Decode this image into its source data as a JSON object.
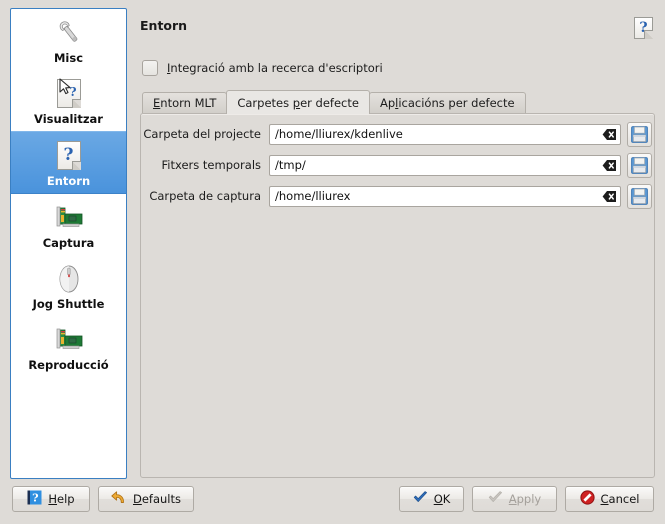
{
  "window": {
    "background": "#dedbd7"
  },
  "sidebar": {
    "items": [
      {
        "label": "Misc",
        "icon": "wrench-icon",
        "selected": false
      },
      {
        "label": "Visualitzar",
        "icon": "document-cursor-icon",
        "selected": false
      },
      {
        "label": "Entorn",
        "icon": "document-question-icon",
        "selected": true
      },
      {
        "label": "Captura",
        "icon": "pci-card-icon",
        "selected": false
      },
      {
        "label": "Jog Shuttle",
        "icon": "mouse-icon",
        "selected": false
      },
      {
        "label": "Reproducció",
        "icon": "pci-card-icon",
        "selected": false
      }
    ],
    "selection_color": "#4a93dc",
    "border_color": "#3a7fc2"
  },
  "main": {
    "title": "Entorn",
    "help_icon": "document-question-icon",
    "checkbox": {
      "label": "Integració amb la recerca d'escriptori",
      "accelerator": "I",
      "checked": false
    },
    "tabs": [
      {
        "label": "Entorn MLT",
        "accelerator": "E",
        "active": false
      },
      {
        "label": "Carpetes per defecte",
        "accelerator": "p",
        "active": true
      },
      {
        "label": "Aplicacións per defecte",
        "accelerator": "l",
        "active": false
      }
    ],
    "fields": [
      {
        "label": "Carpeta del projecte",
        "value": "/home/lliurex/kdenlive",
        "placeholder": "",
        "clear_icon": "clear-text-icon",
        "browse_icon": "save-folder-icon"
      },
      {
        "label": "Fitxers temporals",
        "value": "/tmp/",
        "placeholder": "",
        "clear_icon": "clear-text-icon",
        "browse_icon": "save-folder-icon"
      },
      {
        "label": "Carpeta de captura",
        "value": "/home/lliurex",
        "placeholder": "",
        "clear_icon": "clear-text-icon",
        "browse_icon": "save-folder-icon"
      }
    ]
  },
  "buttons": {
    "help": {
      "label": "Help",
      "accelerator": "H",
      "icon": "help-question-icon",
      "enabled": true
    },
    "defaults": {
      "label": "Defaults",
      "accelerator": "D",
      "icon": "undo-arrow-icon",
      "enabled": true
    },
    "ok": {
      "label": "OK",
      "accelerator": "O",
      "icon": "checkmark-icon",
      "enabled": true
    },
    "apply": {
      "label": "Apply",
      "accelerator": "A",
      "icon": "checkmark-icon",
      "enabled": false
    },
    "cancel": {
      "label": "Cancel",
      "accelerator": "C",
      "icon": "cancel-circle-icon",
      "enabled": true
    }
  },
  "colors": {
    "accent_blue": "#4a93dc",
    "ok_blue": "#2a62b0",
    "cancel_red": "#cc2222",
    "defaults_orange": "#e89b2a",
    "window_bg": "#dedbd7",
    "panel_bg": "#dedbd7",
    "field_bg": "#ffffff"
  }
}
